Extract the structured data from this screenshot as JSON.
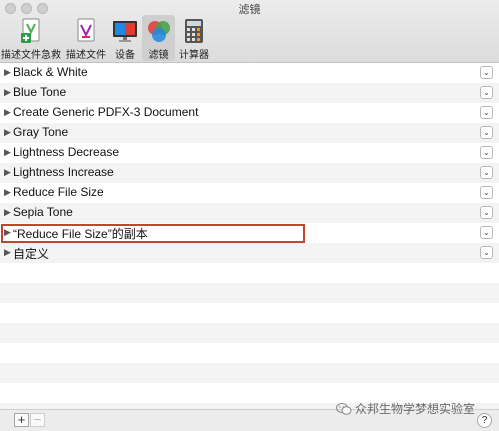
{
  "window": {
    "title": "滤镜"
  },
  "toolbar": {
    "items": [
      {
        "label": "描述文件急救",
        "icon": "profile-first-aid-icon"
      },
      {
        "label": "描述文件",
        "icon": "profiles-icon"
      },
      {
        "label": "设备",
        "icon": "devices-icon"
      },
      {
        "label": "滤镜",
        "icon": "filters-icon",
        "selected": true
      },
      {
        "label": "计算器",
        "icon": "calculator-icon"
      }
    ]
  },
  "filters": {
    "items": [
      {
        "label": "Black & White"
      },
      {
        "label": "Blue Tone"
      },
      {
        "label": "Create Generic PDFX-3 Document"
      },
      {
        "label": "Gray Tone"
      },
      {
        "label": "Lightness Decrease"
      },
      {
        "label": "Lightness Increase"
      },
      {
        "label": "Reduce File Size"
      },
      {
        "label": "Sepia Tone"
      },
      {
        "label": "“Reduce File Size”的副本",
        "highlighted": true
      },
      {
        "label": "自定义"
      }
    ],
    "expand_glyph": "▶",
    "menu_glyph": "⌄"
  },
  "bottombar": {
    "add_label": "+",
    "remove_label": "−",
    "help_label": "?"
  },
  "watermark": {
    "text": "众邦生物学梦想实验室"
  },
  "colors": {
    "highlight_border": "#c2462e",
    "row_stripe": "#f3f3f3",
    "toolbar_bg": "#e4e4e4"
  }
}
